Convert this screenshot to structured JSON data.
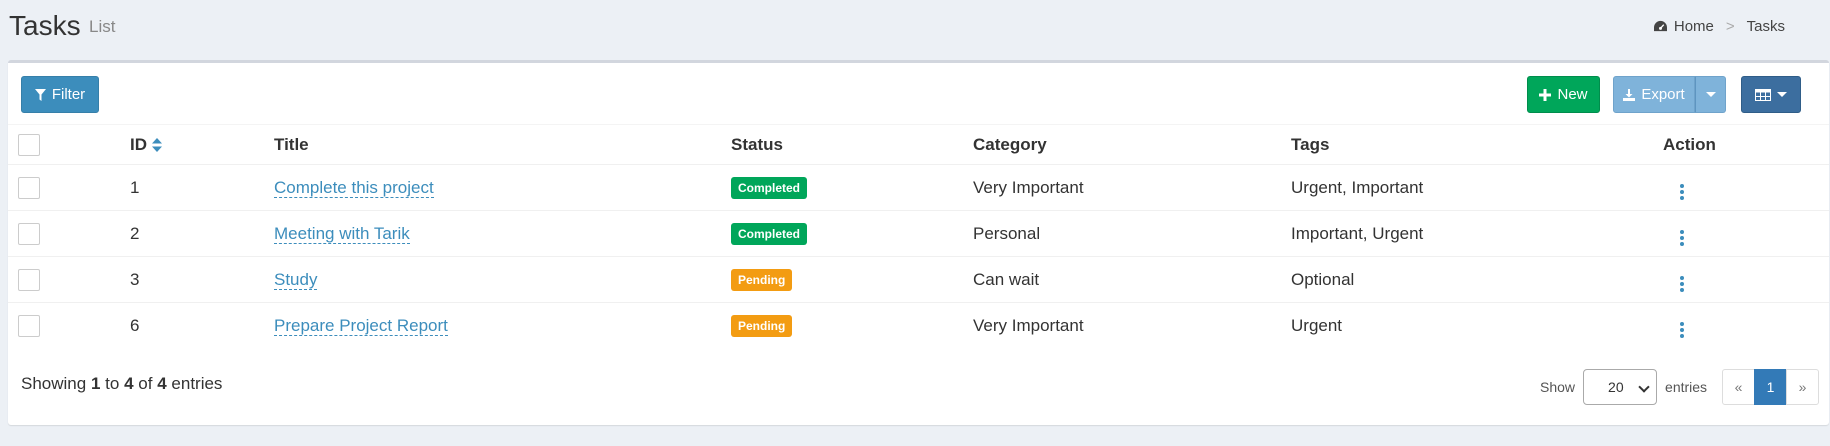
{
  "header": {
    "title": "Tasks",
    "subtitle": "List",
    "breadcrumb": {
      "home": "Home",
      "separator": ">",
      "current": "Tasks"
    }
  },
  "toolbar": {
    "filter_label": "Filter",
    "new_label": "New",
    "export_label": "Export"
  },
  "table": {
    "columns": [
      "ID",
      "Title",
      "Status",
      "Category",
      "Tags",
      "Action"
    ],
    "rows": [
      {
        "id": "1",
        "title": "Complete this project",
        "status": "Completed",
        "category": "Very Important",
        "tags": "Urgent, Important"
      },
      {
        "id": "2",
        "title": "Meeting with Tarik",
        "status": "Completed",
        "category": "Personal",
        "tags": "Important, Urgent"
      },
      {
        "id": "3",
        "title": "Study",
        "status": "Pending",
        "category": "Can wait",
        "tags": "Optional"
      },
      {
        "id": "6",
        "title": "Prepare Project Report",
        "status": "Pending",
        "category": "Very Important",
        "tags": "Urgent"
      }
    ]
  },
  "footer": {
    "showing_prefix": "Showing",
    "from": "1",
    "to_word": "to",
    "to": "4",
    "of_word": "of",
    "total": "4",
    "entries_word": "entries",
    "show_label": "Show",
    "page_length": "20",
    "entries_label": "entries",
    "pager": {
      "prev": "«",
      "current": "1",
      "next": "»"
    }
  },
  "colors": {
    "primary": "#3c8dbc",
    "success": "#00a65a",
    "warning": "#f39c12"
  }
}
